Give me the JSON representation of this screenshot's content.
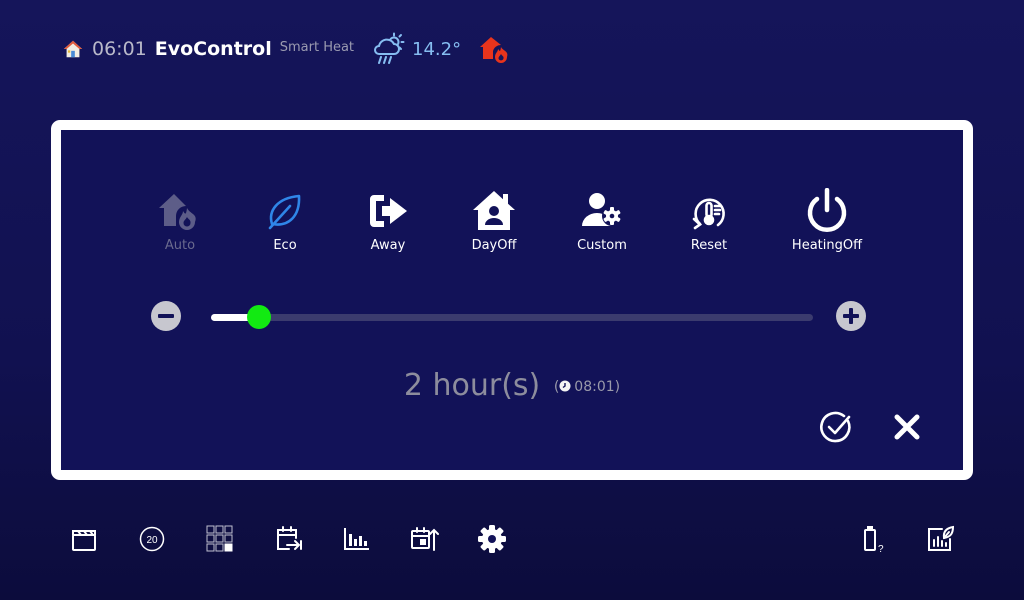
{
  "status_bar": {
    "time": "06:01",
    "app_name": "EvoControl",
    "subtitle": "Smart Heat",
    "temperature": "14.2°"
  },
  "modes": [
    {
      "label": "Auto",
      "icon": "house-flame-icon",
      "active": false
    },
    {
      "label": "Eco",
      "icon": "leaf-icon",
      "active": true
    },
    {
      "label": "Away",
      "icon": "exit-arrow-icon",
      "active": true
    },
    {
      "label": "DayOff",
      "icon": "house-person-icon",
      "active": true
    },
    {
      "label": "Custom",
      "icon": "user-gear-icon",
      "active": true
    },
    {
      "label": "Reset",
      "icon": "reset-thermometer-icon",
      "active": true
    },
    {
      "label": "HeatingOff",
      "icon": "power-icon",
      "active": true
    }
  ],
  "duration": {
    "text": "2 hour(s)",
    "until": "08:01",
    "slider_fraction": 0.08
  },
  "colors": {
    "background": "#121258",
    "slider_knob": "#12ea12",
    "flame": "#e8341c",
    "weather": "#86bdf1"
  }
}
